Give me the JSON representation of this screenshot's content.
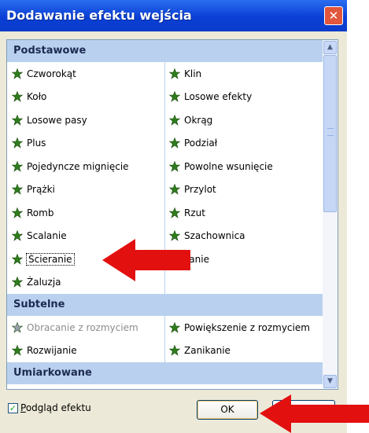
{
  "dialog": {
    "title": "Dodawanie efektu wejścia",
    "close_symbol": "✕"
  },
  "sections": [
    {
      "name": "Podstawowe",
      "rows": [
        [
          {
            "label": "Czworokąt",
            "icon": "star-effect-icon"
          },
          {
            "label": "Klin",
            "icon": "star-effect-icon"
          }
        ],
        [
          {
            "label": "Koło",
            "icon": "star-effect-icon"
          },
          {
            "label": "Losowe efekty",
            "icon": "star-effect-icon"
          }
        ],
        [
          {
            "label": "Losowe pasy",
            "icon": "star-effect-icon"
          },
          {
            "label": "Okrąg",
            "icon": "star-effect-icon"
          }
        ],
        [
          {
            "label": "Plus",
            "icon": "star-effect-icon"
          },
          {
            "label": "Podział",
            "icon": "star-effect-icon"
          }
        ],
        [
          {
            "label": "Pojedyncze mignięcie",
            "icon": "star-effect-icon"
          },
          {
            "label": "Powolne wsunięcie",
            "icon": "star-effect-icon"
          }
        ],
        [
          {
            "label": "Prążki",
            "icon": "star-effect-icon"
          },
          {
            "label": "Przylot",
            "icon": "star-effect-icon"
          }
        ],
        [
          {
            "label": "Romb",
            "icon": "star-effect-icon"
          },
          {
            "label": "Rzut",
            "icon": "star-effect-icon"
          }
        ],
        [
          {
            "label": "Scalanie",
            "icon": "star-effect-icon"
          },
          {
            "label": "Szachownica",
            "icon": "star-effect-icon"
          }
        ],
        [
          {
            "label": "Ścieranie",
            "icon": "star-effect-icon",
            "selected": true
          },
          {
            "label": "zanie",
            "icon": "star-effect-icon"
          }
        ],
        [
          {
            "label": "Żaluzja",
            "icon": "star-effect-icon"
          },
          null
        ]
      ]
    },
    {
      "name": "Subtelne",
      "rows": [
        [
          {
            "label": "Obracanie z rozmyciem",
            "icon": "star-effect-icon",
            "disabled": true
          },
          {
            "label": "Powiększenie z rozmyciem",
            "icon": "star-effect-icon"
          }
        ],
        [
          {
            "label": "Rozwijanie",
            "icon": "star-effect-icon"
          },
          {
            "label": "Zanikanie",
            "icon": "star-effect-icon"
          }
        ]
      ]
    },
    {
      "name": "Umiarkowane",
      "rows": []
    }
  ],
  "scrollbar": {
    "up_symbol": "▲",
    "down_symbol": "▼"
  },
  "footer": {
    "preview_label": "Podgląd efektu",
    "preview_checked": true,
    "ok_label": "OK"
  },
  "colors": {
    "titlebar": "#0a3fd6",
    "section_header": "#b9d1ee",
    "arrow": "#e31010",
    "icon_star": "#2e7d1c"
  }
}
